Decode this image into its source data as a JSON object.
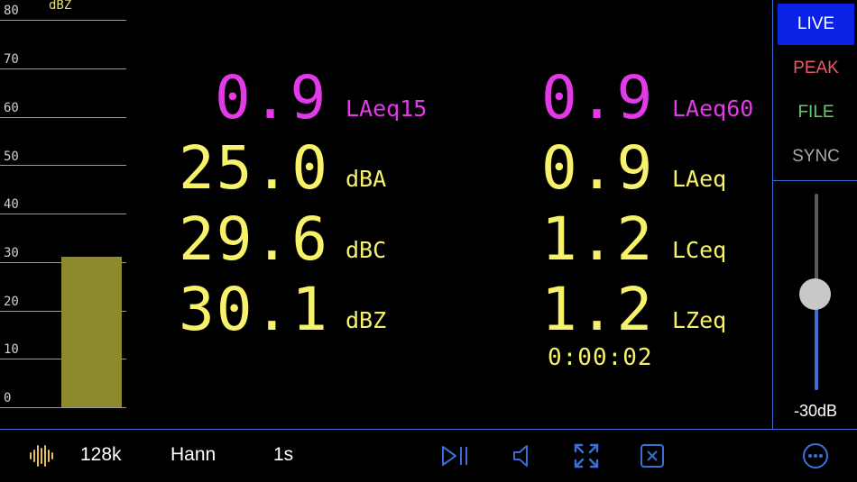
{
  "meter": {
    "unit": "dBZ",
    "ticks": [
      "80",
      "70",
      "60",
      "50",
      "40",
      "30",
      "20",
      "10",
      "0"
    ],
    "level_db": 31,
    "scale_max": 80,
    "bar_color": "#8e8a2c"
  },
  "readouts": {
    "left": [
      {
        "value": "0.9",
        "label": "LAeq15",
        "color": "#e23ae6"
      },
      {
        "value": "25.0",
        "label": "dBA",
        "color": "#f7f26a"
      },
      {
        "value": "29.6",
        "label": "dBC",
        "color": "#f7f26a"
      },
      {
        "value": "30.1",
        "label": "dBZ",
        "color": "#f7f26a"
      }
    ],
    "right": [
      {
        "value": "0.9",
        "label": "LAeq60",
        "color": "#e23ae6"
      },
      {
        "value": "0.9",
        "label": "LAeq",
        "color": "#f7f26a"
      },
      {
        "value": "1.2",
        "label": "LCeq",
        "color": "#f7f26a"
      },
      {
        "value": "1.2",
        "label": "LZeq",
        "color": "#f7f26a"
      }
    ],
    "elapsed": "0:00:02"
  },
  "modes": {
    "live": "LIVE",
    "peak": "PEAK",
    "file": "FILE",
    "sync": "SYNC",
    "live_bg": "#0a22e6",
    "peak_color": "#e8596a",
    "file_color": "#5fd36a",
    "sync_color": "#a8a8a8"
  },
  "gain": {
    "label": "-30dB",
    "level_fraction": 0.49
  },
  "toolbar": {
    "sample_rate": "128k",
    "window": "Hann",
    "interval": "1s",
    "icons": [
      "waveform-icon",
      "play-pause-icon",
      "speaker-icon",
      "expand-icon",
      "clear-icon",
      "more-icon"
    ],
    "accent": "#3a6fd8",
    "waveform_color": "#e5c24a"
  }
}
